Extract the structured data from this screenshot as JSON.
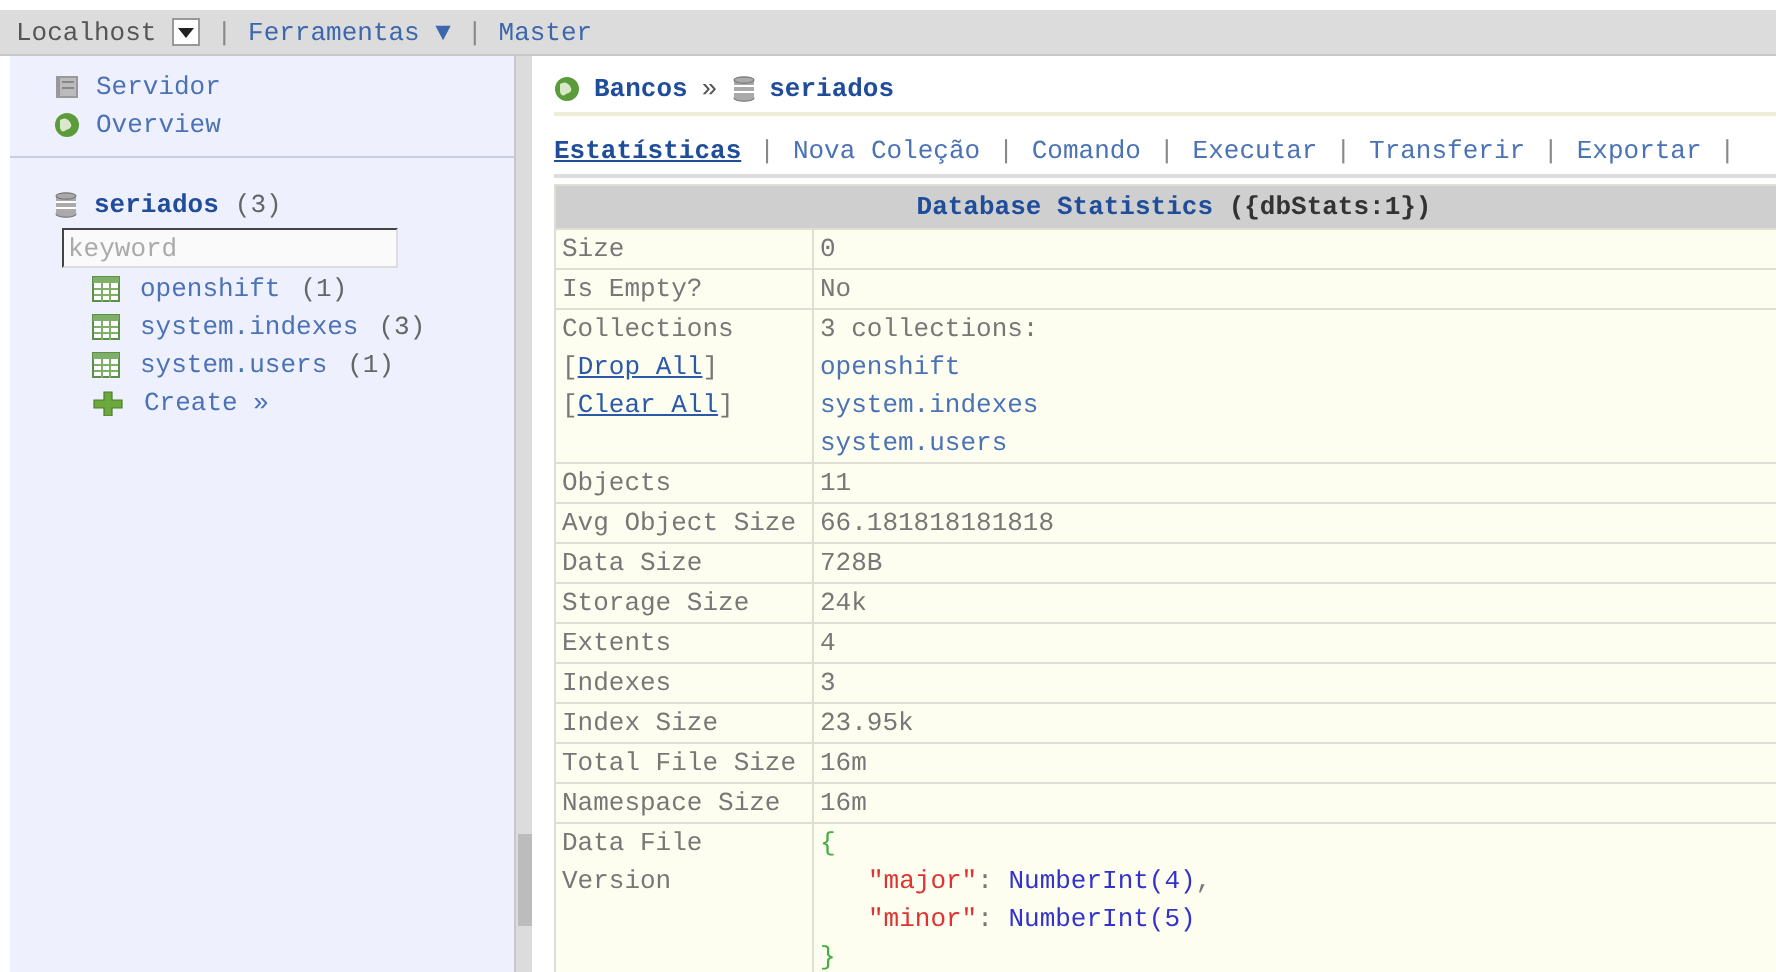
{
  "topbar": {
    "items": [
      {
        "kind": "host",
        "text": "Localhost",
        "separator": "|"
      },
      {
        "kind": "link",
        "text": "Ferramentas ▼",
        "separator": "|"
      },
      {
        "kind": "link",
        "text": "Master"
      }
    ]
  },
  "sidebar": {
    "top_links": [
      {
        "kind": "server",
        "text": "Servidor"
      },
      {
        "kind": "globe",
        "text": "Overview"
      }
    ],
    "database": {
      "name": "seriados",
      "count": "(3)",
      "search": {
        "placeholder": "keyword"
      },
      "collections": [
        {
          "name": "openshift",
          "count": "(1)"
        },
        {
          "name": "system.indexes",
          "count": "(3)"
        },
        {
          "name": "system.users",
          "count": "(1)"
        }
      ],
      "create": "Create »"
    }
  },
  "breadcrumb": {
    "items": [
      "Bancos",
      "seriados"
    ],
    "separator": "»"
  },
  "tabs": [
    {
      "label": "Estatísticas",
      "selected": true,
      "separator": "|"
    },
    {
      "label": "Nova Coleção",
      "selected": false,
      "separator": "|"
    },
    {
      "label": "Comando",
      "selected": false,
      "separator": "|"
    },
    {
      "label": "Executar",
      "selected": false,
      "separator": "|"
    },
    {
      "label": "Transferir",
      "selected": false,
      "separator": "|"
    },
    {
      "label": "Exportar",
      "selected": false,
      "separator": "|"
    }
  ],
  "stats": {
    "title": "Database Statistics",
    "command": "({dbStats:1})",
    "rows": [
      {
        "kind": "text",
        "label": "Size",
        "value": "0"
      },
      {
        "kind": "text",
        "label": "Is Empty?",
        "value": "No"
      },
      {
        "kind": "collections",
        "label": "Collections",
        "actions": [
          {
            "open": "[",
            "text": "Drop All",
            "close": "]"
          },
          {
            "open": "[",
            "text": "Clear All",
            "close": "]"
          }
        ],
        "summary": "3 collections:",
        "items": [
          "openshift",
          "system.indexes",
          "system.users"
        ]
      },
      {
        "kind": "text",
        "label": "Objects",
        "value": "11"
      },
      {
        "kind": "text",
        "label": "Avg Object Size",
        "value": "66.181818181818"
      },
      {
        "kind": "text",
        "label": "Data Size",
        "value": "728B"
      },
      {
        "kind": "text",
        "label": "Storage Size",
        "value": "24k"
      },
      {
        "kind": "text",
        "label": "Extents",
        "value": "4"
      },
      {
        "kind": "text",
        "label": "Indexes",
        "value": "3"
      },
      {
        "kind": "text",
        "label": "Index Size",
        "value": "23.95k"
      },
      {
        "kind": "text",
        "label": "Total File Size",
        "value": "16m"
      },
      {
        "kind": "text",
        "label": "Namespace Size",
        "value": "16m"
      },
      {
        "kind": "json",
        "label": "Data File Version",
        "open": "{",
        "entries": [
          {
            "key": "\"major\"",
            "punct": ":",
            "value": "NumberInt(4)",
            "trail": ","
          },
          {
            "key": "\"minor\"",
            "punct": ":",
            "value": "NumberInt(5)"
          }
        ],
        "close": "}"
      }
    ]
  }
}
